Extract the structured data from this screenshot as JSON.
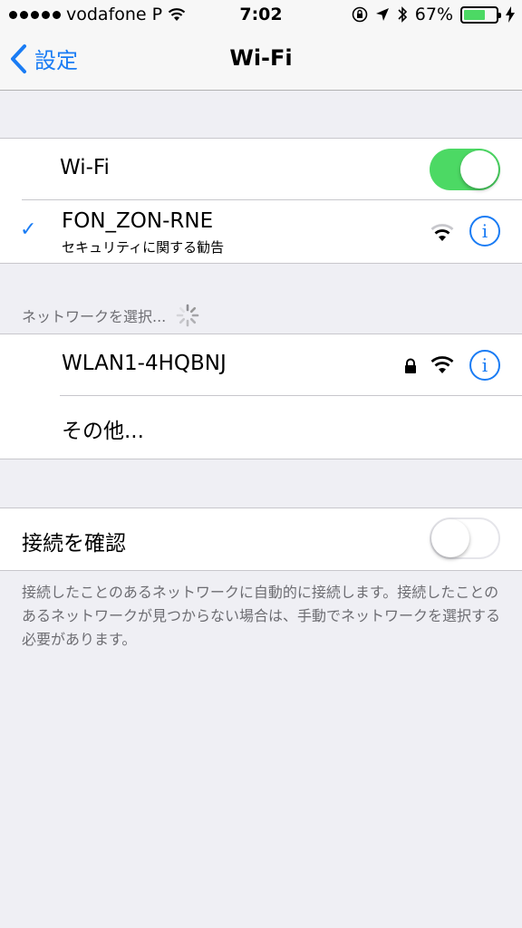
{
  "status_bar": {
    "carrier": "vodafone P",
    "time": "7:02",
    "battery_percent": "67%",
    "battery_level": 0.67,
    "signal_bars": 5
  },
  "navbar": {
    "back_label": "設定",
    "title": "Wi-Fi"
  },
  "wifi_toggle": {
    "label": "Wi-Fi",
    "on": true
  },
  "connected_network": {
    "name": "FON_ZON-RNE",
    "subtitle": "セキュリティに関する勧告",
    "selected": true
  },
  "networks_section": {
    "header": "ネットワークを選択..."
  },
  "networks": [
    {
      "name": "WLAN1-4HQBNJ",
      "secured": true
    },
    {
      "name": "その他...",
      "secured": false
    }
  ],
  "ask_to_join": {
    "label": "接続を確認",
    "on": false
  },
  "footer": {
    "text": "接続したことのあるネットワークに自動的に接続します。接続したことのあるネットワークが見つからない場合は、手動でネットワークを選択する必要があります。"
  },
  "colors": {
    "accent": "#1a7cf4",
    "toggle_on": "#4cd964",
    "background": "#efeff4"
  },
  "icons": {
    "info": "i"
  }
}
